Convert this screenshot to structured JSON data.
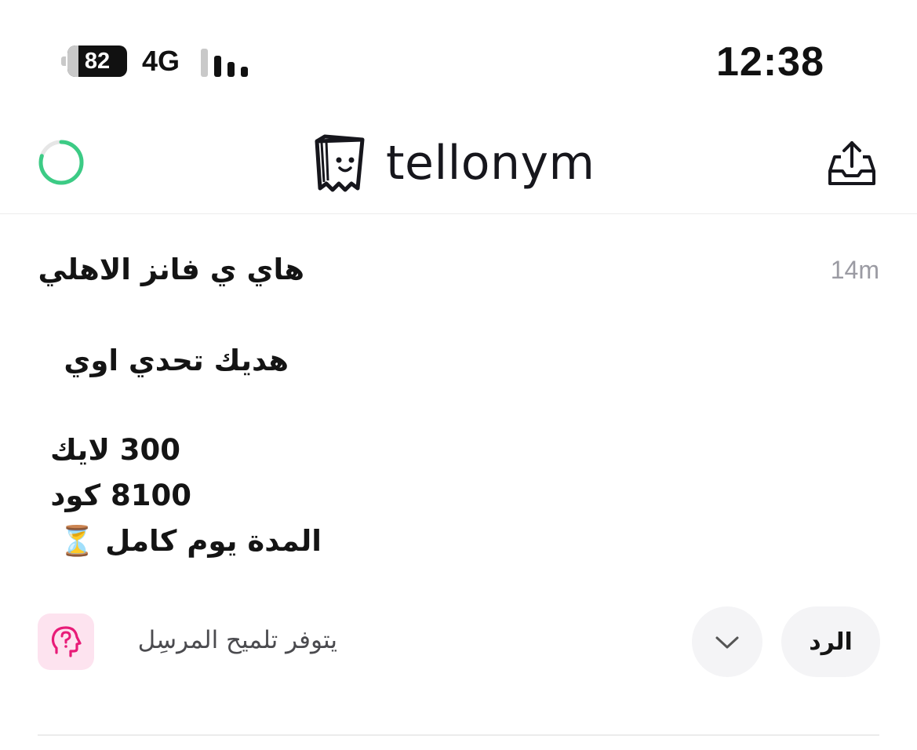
{
  "status_bar": {
    "battery_percent": "82",
    "network": "4G",
    "time": "12:38",
    "signal_bars_active": 3,
    "signal_bars_total": 4
  },
  "header": {
    "logo_text": "tellonym",
    "spinner_color": "#3ccb85",
    "spinner_progress": 0.8
  },
  "message": {
    "lines": [
      "هاي ي فانز الاهلي",
      "هديك تحدي اوي",
      "300 لايك",
      "8100 كود",
      "المدة يوم كامل ⏳"
    ],
    "time": "14m"
  },
  "actions": {
    "hint_text": "يتوفر تلميح المرسِل",
    "reply_label": "الرد",
    "hint_icon_color": "#e81c78",
    "hint_bg_color": "#fde3ef"
  },
  "icons": {
    "hint": "head-question-icon",
    "more": "chevron-down-icon",
    "share": "share-tray-icon",
    "logo": "ghost-logo-icon"
  }
}
